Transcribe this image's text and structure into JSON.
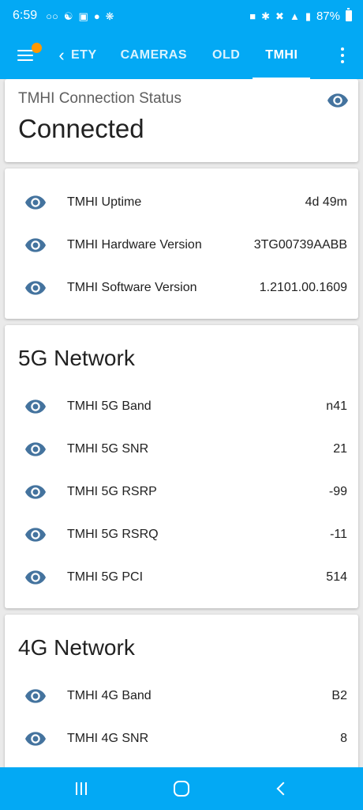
{
  "statusbar": {
    "time": "6:59",
    "battery": "87%"
  },
  "appbar": {
    "tabs": [
      {
        "label": "ETY",
        "active": false
      },
      {
        "label": "CAMERAS",
        "active": false
      },
      {
        "label": "OLD",
        "active": false
      },
      {
        "label": "TMHI",
        "active": true
      }
    ]
  },
  "status_card": {
    "label": "TMHI Connection Status",
    "value": "Connected"
  },
  "info_card": {
    "rows": [
      {
        "name": "TMHI Uptime",
        "value": "4d 49m"
      },
      {
        "name": "TMHI Hardware Version",
        "value": "3TG00739AABB"
      },
      {
        "name": "TMHI Software Version",
        "value": "1.2101.00.1609"
      }
    ]
  },
  "network_5g": {
    "title": "5G Network",
    "rows": [
      {
        "name": "TMHI 5G Band",
        "value": "n41"
      },
      {
        "name": "TMHI 5G SNR",
        "value": "21"
      },
      {
        "name": "TMHI 5G RSRP",
        "value": "-99"
      },
      {
        "name": "TMHI 5G RSRQ",
        "value": "-11"
      },
      {
        "name": "TMHI 5G PCI",
        "value": "514"
      }
    ]
  },
  "network_4g": {
    "title": "4G Network",
    "rows": [
      {
        "name": "TMHI 4G Band",
        "value": "B2"
      },
      {
        "name": "TMHI 4G SNR",
        "value": "8"
      }
    ]
  },
  "colors": {
    "primary": "#03a9f4",
    "accent_badge": "#ff9800",
    "eye_icon": "#44739e"
  },
  "icons": {
    "row_icon": "eye-icon",
    "menu": "hamburger-icon",
    "overflow": "more-vert-icon"
  }
}
